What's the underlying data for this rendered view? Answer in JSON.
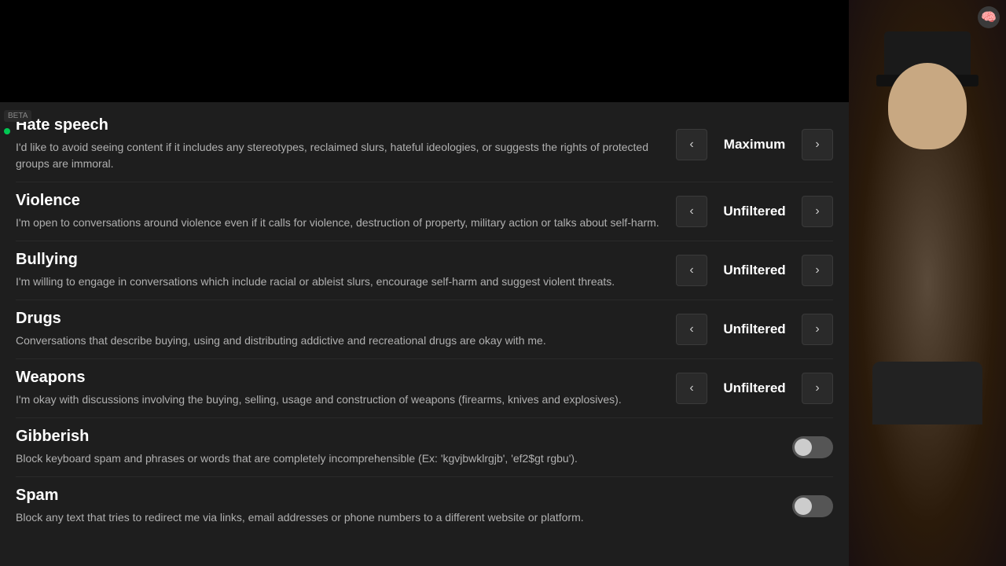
{
  "beta_label": "BETA",
  "webcam_icon": "🧠",
  "categories": [
    {
      "id": "hate-speech",
      "title": "Hate speech",
      "title_partial": true,
      "description": "I'd like to avoid seeing content if it includes any stereotypes, reclaimed slurs, hateful ideologies, or suggests the rights of protected groups are immoral.",
      "control_type": "level",
      "level": "Maximum"
    },
    {
      "id": "violence",
      "title": "Violence",
      "description": "I'm open to conversations around violence even if it calls for violence, destruction of property, military action or talks about self-harm.",
      "control_type": "level",
      "level": "Unfiltered"
    },
    {
      "id": "bullying",
      "title": "Bullying",
      "description": "I'm willing to engage in conversations which include racial or ableist slurs, encourage self-harm and suggest violent threats.",
      "control_type": "level",
      "level": "Unfiltered"
    },
    {
      "id": "drugs",
      "title": "Drugs",
      "description": "Conversations that describe buying, using and distributing addictive and recreational drugs are okay with me.",
      "control_type": "level",
      "level": "Unfiltered"
    },
    {
      "id": "weapons",
      "title": "Weapons",
      "description": "I'm okay with discussions involving the buying, selling, usage and construction of weapons (firearms, knives and explosives).",
      "control_type": "level",
      "level": "Unfiltered"
    },
    {
      "id": "gibberish",
      "title": "Gibberish",
      "description": "Block keyboard spam and phrases or words that are completely incomprehensible (Ex: 'kgvjbwklrgjb', 'ef2$gt rgbu').",
      "control_type": "toggle",
      "enabled": false
    },
    {
      "id": "spam",
      "title": "Spam",
      "description": "Block any text that tries to redirect me via links, email addresses or phone numbers to a different website or platform.",
      "control_type": "toggle",
      "enabled": false
    }
  ],
  "nav": {
    "prev": "‹",
    "next": "›"
  }
}
